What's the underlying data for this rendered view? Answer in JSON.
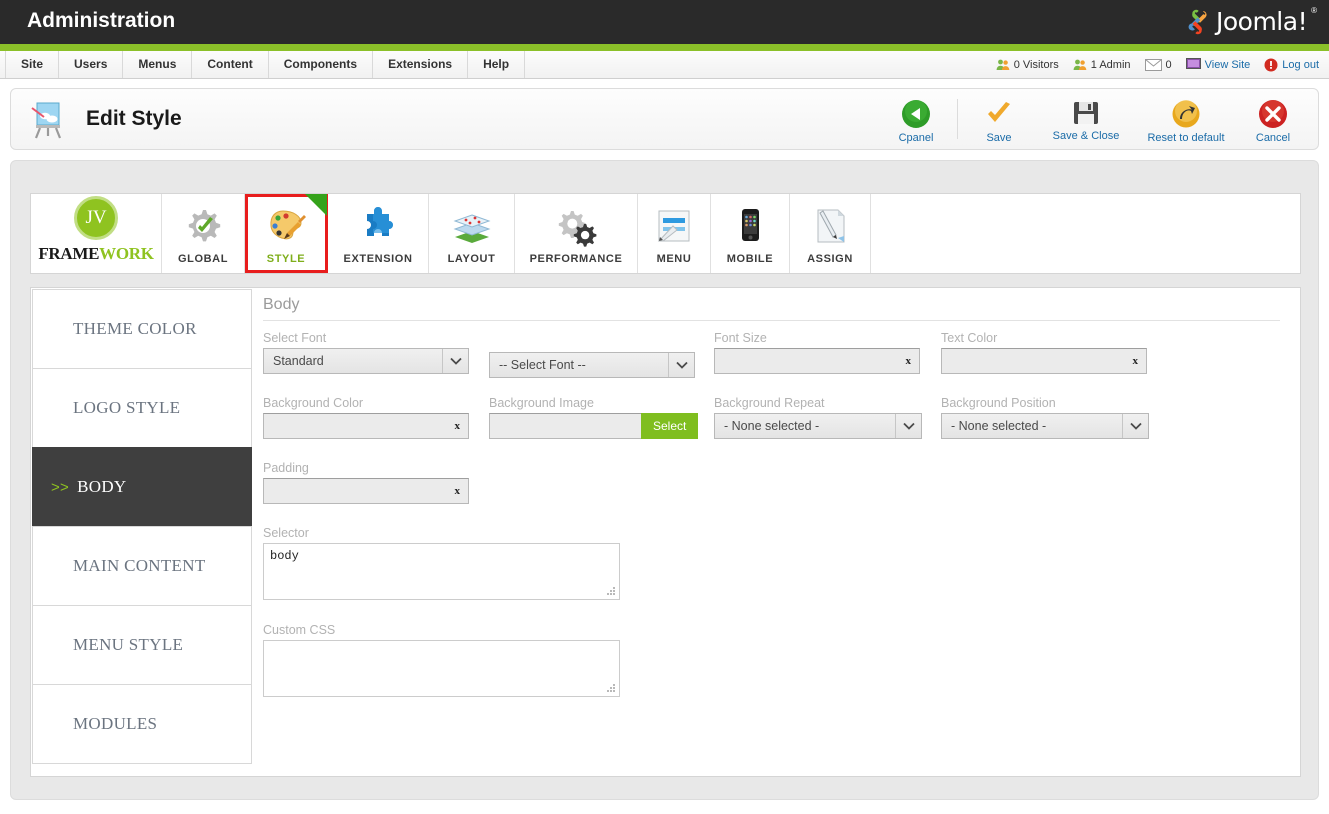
{
  "header": {
    "admin_title": "Administration",
    "brand": "Joomla!",
    "brand_tm": "®"
  },
  "menubar": {
    "items": [
      {
        "label": "Site",
        "name": "site"
      },
      {
        "label": "Users",
        "name": "users"
      },
      {
        "label": "Menus",
        "name": "menus"
      },
      {
        "label": "Content",
        "name": "content"
      },
      {
        "label": "Components",
        "name": "components"
      },
      {
        "label": "Extensions",
        "name": "extensions"
      },
      {
        "label": "Help",
        "name": "help"
      }
    ],
    "status": {
      "visitors": "0 Visitors",
      "admins": "1 Admin",
      "messages": "0",
      "view_site": "View Site",
      "log_out": "Log out"
    }
  },
  "titlebar": {
    "page_title": "Edit Style",
    "icon": "easel-icon",
    "toolbar": [
      {
        "label": "Cpanel",
        "name": "cpanel",
        "icon": "back-arrow-icon"
      },
      {
        "label": "Save",
        "name": "save",
        "icon": "checkmark-icon"
      },
      {
        "label": "Save & Close",
        "name": "save-and-close",
        "icon": "floppy-disk-icon"
      },
      {
        "label": "Reset to default",
        "name": "reset-to-default",
        "icon": "redo-arrow-icon"
      },
      {
        "label": "Cancel",
        "name": "cancel",
        "icon": "close-x-icon"
      }
    ]
  },
  "tabs": {
    "framework": {
      "badge": "JV",
      "word_a": "FRAME",
      "word_b": "WORK"
    },
    "items": [
      {
        "label": "GLOBAL",
        "name": "global",
        "icon": "gear-check-icon",
        "active": false
      },
      {
        "label": "STYLE",
        "name": "style",
        "icon": "palette-icon",
        "active": true
      },
      {
        "label": "EXTENSION",
        "name": "extension",
        "icon": "puzzle-piece-icon",
        "active": false
      },
      {
        "label": "LAYOUT",
        "name": "layout",
        "icon": "layers-map-icon",
        "active": false
      },
      {
        "label": "PERFORMANCE",
        "name": "performance",
        "icon": "two-gears-icon",
        "active": false
      },
      {
        "label": "MENU",
        "name": "menu",
        "icon": "pencil-page-icon",
        "active": false
      },
      {
        "label": "MOBILE",
        "name": "mobile",
        "icon": "smartphone-icon",
        "active": false
      },
      {
        "label": "ASSIGN",
        "name": "assign",
        "icon": "pen-document-icon",
        "active": false
      }
    ]
  },
  "sidebar": {
    "items": [
      {
        "label": "THEME COLOR",
        "name": "theme-color",
        "active": false,
        "arrows": ""
      },
      {
        "label": "LOGO STYLE",
        "name": "logo-style",
        "active": false,
        "arrows": ""
      },
      {
        "label": "BODY",
        "name": "body",
        "active": true,
        "arrows": ">>"
      },
      {
        "label": "MAIN CONTENT",
        "name": "main-content",
        "active": false,
        "arrows": ""
      },
      {
        "label": "MENU STYLE",
        "name": "menu-style",
        "active": false,
        "arrows": ""
      },
      {
        "label": "MODULES",
        "name": "modules",
        "active": false,
        "arrows": ""
      }
    ]
  },
  "form": {
    "section_title": "Body",
    "select_font": {
      "label": "Select Font",
      "type_value": "Standard",
      "font_value": "-- Select Font --"
    },
    "font_size": {
      "label": "Font Size",
      "value": "",
      "clear": "x"
    },
    "text_color": {
      "label": "Text Color",
      "value": "",
      "clear": "x"
    },
    "background_color": {
      "label": "Background Color",
      "value": "",
      "clear": "x"
    },
    "background_image": {
      "label": "Background Image",
      "value": "",
      "button": "Select"
    },
    "background_repeat": {
      "label": "Background Repeat",
      "value": "- None selected -"
    },
    "background_position": {
      "label": "Background Position",
      "value": "- None selected -"
    },
    "padding": {
      "label": "Padding",
      "value": "",
      "clear": "x"
    },
    "selector": {
      "label": "Selector",
      "value": "body"
    },
    "custom_css": {
      "label": "Custom CSS",
      "value": ""
    }
  },
  "colors": {
    "green_accent": "#8bc029",
    "link_blue": "#1b6ca8",
    "active_dark": "#3f3f3f",
    "highlight_red": "#e81d1d",
    "select_button_green": "#7fbe1f"
  }
}
